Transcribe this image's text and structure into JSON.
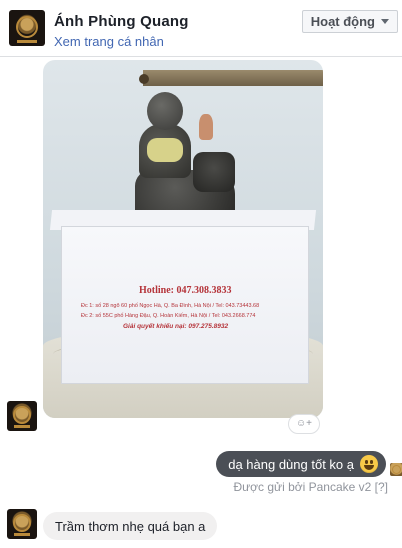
{
  "header": {
    "name": "Ánh Phùng Quang",
    "profile_link": "Xem trang cá nhân",
    "status_label": "Hoạt động"
  },
  "photo": {
    "hotline": "Hotline: 047.308.3833",
    "address_1": "Đc 1: số 28 ngõ 60 phố Ngọc Hà, Q. Ba Đình, Hà Nội / Tel: 043.73443.68",
    "address_2": "Đc 2: số 55C phố Hàng Đậu, Q. Hoàn Kiếm, Hà Nội / Tel: 043.2668.774",
    "complaint_line": "Giải quyết khiếu nại: 097.275.8932"
  },
  "reaction": {
    "label": "☺+"
  },
  "messages": [
    {
      "direction": "outgoing",
      "text": "dạ hàng dùng tốt ko ạ",
      "emoji": "smiley-emoji"
    },
    {
      "direction": "meta",
      "text": "Được gửi bởi Pancake v2 [?]"
    },
    {
      "direction": "incoming",
      "text": "Trầm thơm nhẹ quá bạn a"
    }
  ],
  "colors": {
    "link": "#4267b2",
    "outgoing_bubble": "#4b4f56",
    "incoming_bubble": "#f1f0f0",
    "meta_text": "#90949c",
    "hotline_red": "#b5343a"
  }
}
